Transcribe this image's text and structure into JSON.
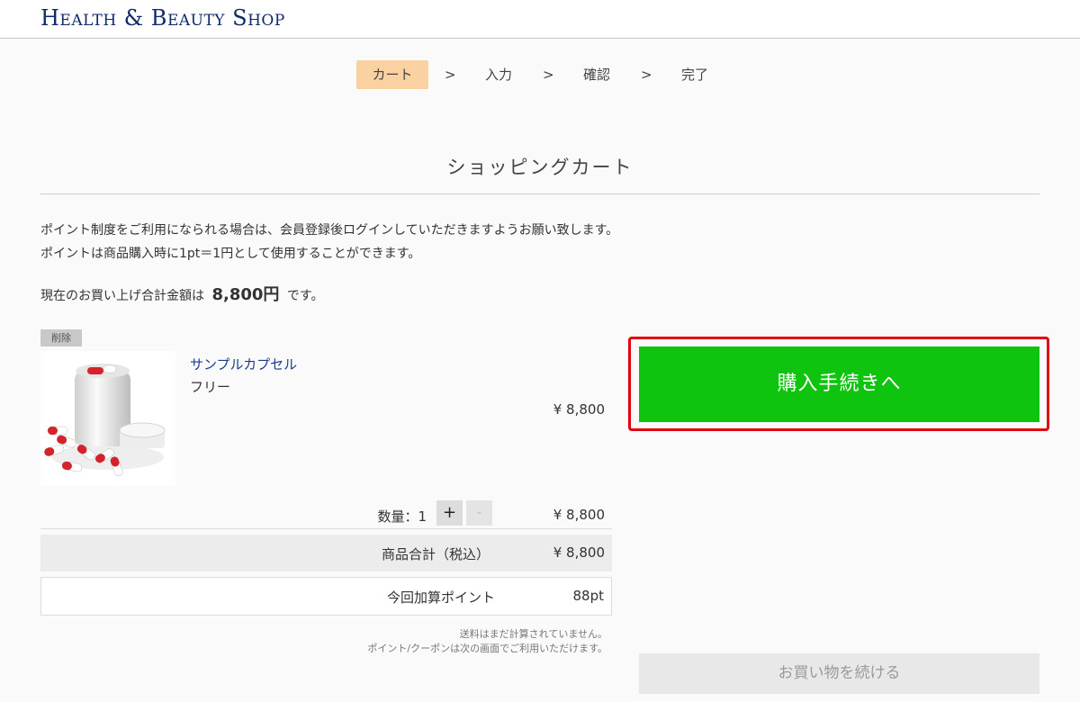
{
  "header": {
    "logo": "Health & Beauty Shop"
  },
  "steps": {
    "cart": "カート",
    "input": "入力",
    "confirm": "確認",
    "done": "完了",
    "separator": ">"
  },
  "page": {
    "title": "ショッピングカート"
  },
  "notice": {
    "line1": "ポイント制度をご利用になられる場合は、会員登録後ログインしていただきますようお願い致します。",
    "line2": "ポイントは商品購入時に1pt＝1円として使用することができます。"
  },
  "total_message": {
    "prefix": "現在のお買い上げ合計金額は",
    "amount": "8,800円",
    "suffix": "です。"
  },
  "cart": {
    "delete_label": "削除",
    "item": {
      "name": "サンプルカプセル",
      "variant": "フリー",
      "unit_price": "¥ 8,800"
    },
    "quantity_label": "数量：1",
    "plus_label": "+",
    "minus_label": "-",
    "line_price": "¥ 8,800",
    "subtotal_label": "商品合計（税込）",
    "subtotal_value": "¥ 8,800",
    "points_label": "今回加算ポイント",
    "points_value": "88pt",
    "note1": "送料はまだ計算されていません。",
    "note2": "ポイント/クーポンは次の画面でご利用いただけます。"
  },
  "actions": {
    "checkout_label": "購入手続きへ",
    "continue_label": "お買い物を続ける"
  },
  "colors": {
    "accent_green": "#0ec40e",
    "highlight_red": "#e2000f",
    "step_active": "#fad1a1",
    "brand_navy": "#0f2a6b"
  }
}
